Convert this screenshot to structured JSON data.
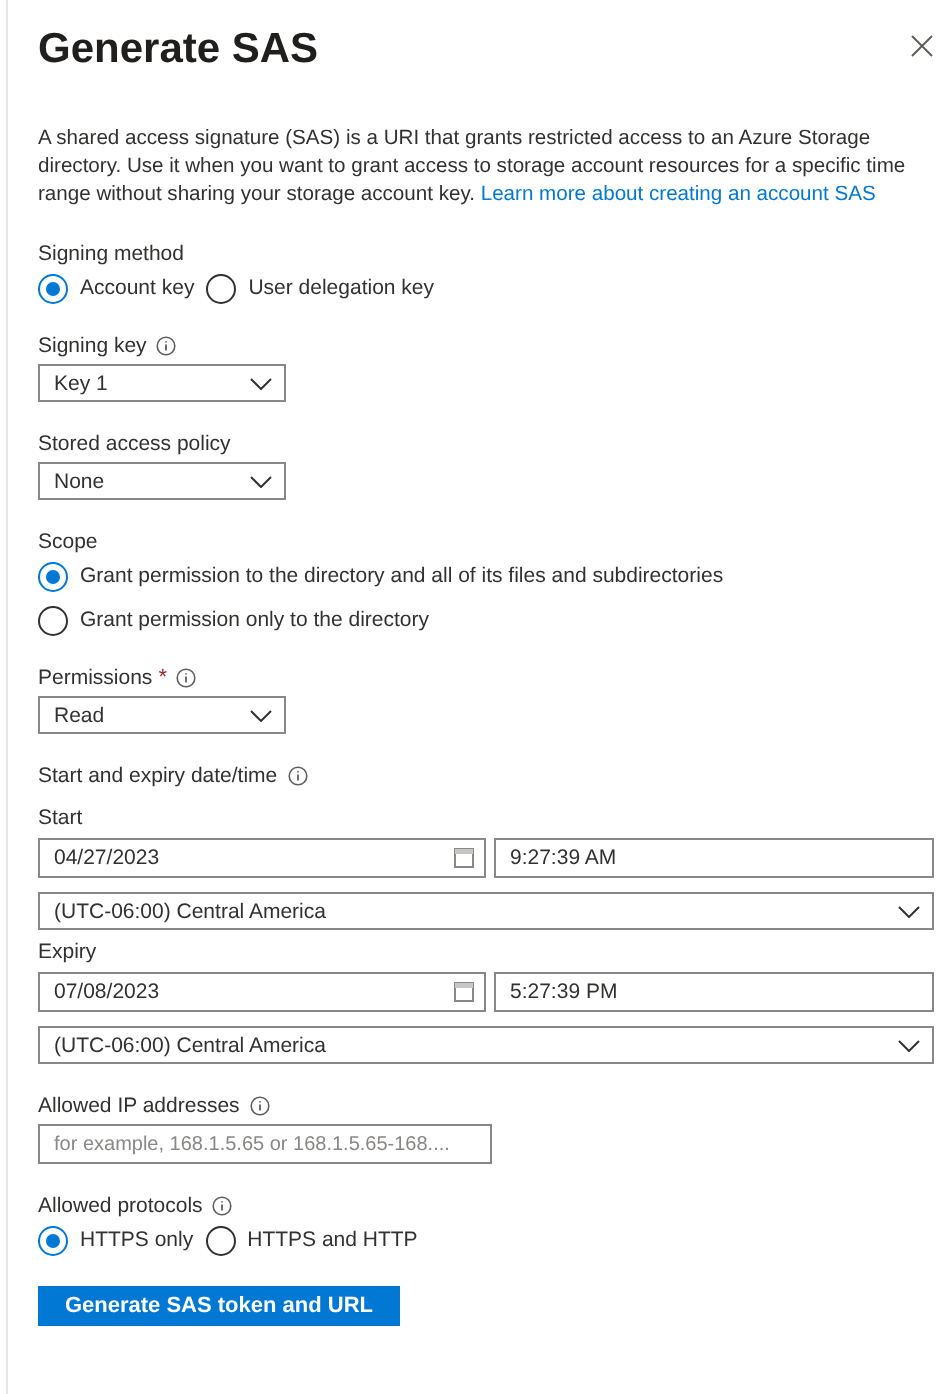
{
  "title": "Generate SAS",
  "description": "A shared access signature (SAS) is a URI that grants restricted access to an Azure Storage directory. Use it when you want to grant access to storage account resources for a specific time range without sharing your storage account key.",
  "link": "Learn more about creating an account SAS",
  "fields": [
    {
      "kind": "radio_group",
      "label": "Signing method",
      "inline": true,
      "options": [
        {
          "label": "Account key",
          "selected": true
        },
        {
          "label": "User delegation key",
          "selected": false
        }
      ]
    },
    {
      "kind": "select",
      "label": "Signing key",
      "info": true,
      "value": "Key 1"
    },
    {
      "kind": "select",
      "label": "Stored access policy",
      "value": "None"
    },
    {
      "kind": "radio_group",
      "label": "Scope",
      "inline": false,
      "options": [
        {
          "label": "Grant permission to the directory and all of its files and subdirectories",
          "selected": true
        },
        {
          "label": "Grant permission only to the directory",
          "selected": false
        }
      ]
    },
    {
      "kind": "select",
      "label": "Permissions",
      "info": true,
      "required_mark": "*",
      "value": "Read"
    },
    {
      "kind": "datetime",
      "label": "Start and expiry date/time",
      "info": true,
      "groups": [
        {
          "label": "Start",
          "date": "04/27/2023",
          "time": "9:27:39 AM",
          "timezone": "(UTC-06:00) Central America"
        },
        {
          "label": "Expiry",
          "date": "07/08/2023",
          "time": "5:27:39 PM",
          "timezone": "(UTC-06:00) Central America"
        }
      ]
    },
    {
      "kind": "text",
      "label": "Allowed IP addresses",
      "info": true,
      "placeholder": "for example, 168.1.5.65 or 168.1.5.65-168...."
    },
    {
      "kind": "radio_group",
      "label": "Allowed protocols",
      "info": true,
      "inline": true,
      "options": [
        {
          "label": "HTTPS only",
          "selected": true
        },
        {
          "label": "HTTPS and HTTP",
          "selected": false
        }
      ]
    }
  ],
  "button": "Generate SAS token and URL"
}
